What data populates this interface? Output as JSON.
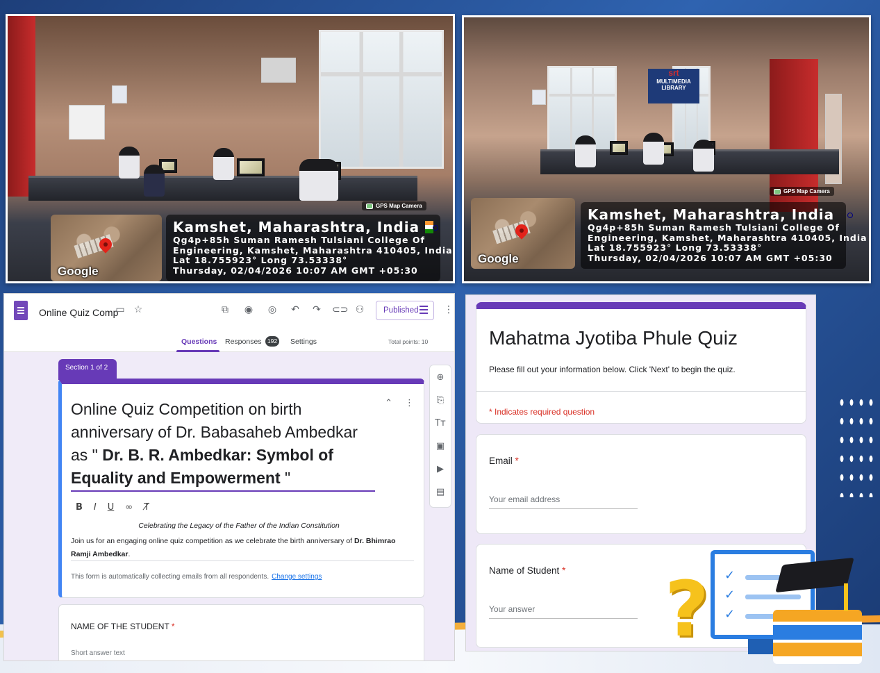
{
  "photos": [
    {
      "gps_tag": "GPS Map Camera",
      "location": "Kamshet, Maharashtra, India",
      "address_line1": "Qg4p+85h Suman Ramesh Tulsiani College Of",
      "address_line2": "Engineering, Kamshet, Maharashtra 410405, India",
      "coords": "Lat 18.755923° Long 73.53338°",
      "datetime": "Thursday, 02/04/2026 10:07 AM GMT +05:30",
      "map_label": "Google"
    },
    {
      "gps_tag": "GPS Map Camera",
      "location": "Kamshet, Maharashtra, India",
      "address_line1": "Qg4p+85h Suman Ramesh Tulsiani College Of",
      "address_line2": "Engineering, Kamshet, Maharashtra 410405, India",
      "coords": "Lat 18.755923° Long 73.53338°",
      "datetime": "Thursday, 02/04/2026 10:07 AM GMT +05:30",
      "map_label": "Google",
      "sign_logo": "srt",
      "sign_text": "MULTIMEDIA LIBRARY"
    }
  ],
  "editor": {
    "doc_title": "Online Quiz Comp",
    "published_label": "Published",
    "tabs": [
      {
        "label": "Questions"
      },
      {
        "label": "Responses"
      },
      {
        "label": "Settings"
      }
    ],
    "responses_count": "192",
    "total_points": "Total points: 10",
    "section_tag": "Section 1 of 2",
    "form_title_plain": "Online Quiz Competition on birth anniversary of Dr. Babasaheb Ambedkar as \" ",
    "form_title_bold": "Dr. B. R. Ambedkar: Symbol of Equality and Empowerment",
    "form_title_end": " \"",
    "desc_italic": "Celebrating the Legacy of the Father of the Indian Constitution",
    "desc_body": "Join us for an engaging online quiz competition as we celebrate the birth anniversary of ",
    "desc_body_bold": "Dr. Bhimrao Ramji Ambedkar",
    "desc_body_end": ".",
    "collect_note": "This form is automatically collecting emails from all respondents.",
    "change_settings": "Change settings",
    "question_label": "NAME OF THE STUDENT",
    "question_placeholder": "Short answer text",
    "required_mark": "*"
  },
  "form_view": {
    "title": "Mahatma Jyotiba Phule Quiz",
    "description": "Please fill out your information below. Click 'Next' to begin the quiz.",
    "required_note": "* Indicates required question",
    "questions": [
      {
        "label": "Email",
        "placeholder": "Your email address"
      },
      {
        "label": "Name of Student",
        "placeholder": "Your answer"
      }
    ],
    "required_mark": "*"
  },
  "colors": {
    "forms_purple": "#673ab7",
    "required_red": "#d93025",
    "link_blue": "#1a73e8"
  },
  "icons": {
    "toolbar": [
      "addon-icon",
      "palette-icon",
      "preview-eye-icon",
      "undo-icon",
      "redo-icon",
      "link-icon",
      "add-collaborator-icon",
      "more-vert-icon"
    ],
    "side_toolbar": [
      "add-question-icon",
      "import-questions-icon",
      "add-title-icon",
      "add-image-icon",
      "add-video-icon",
      "add-section-icon"
    ]
  }
}
